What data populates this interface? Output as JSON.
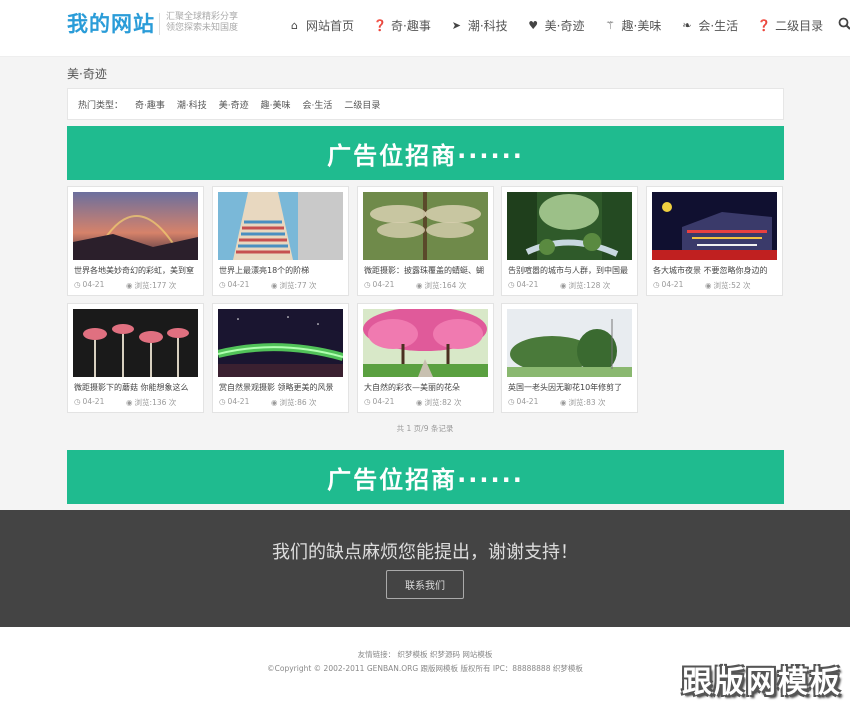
{
  "header": {
    "logo": "我的网站",
    "slogan_line1": "汇聚全球精彩分享",
    "slogan_line2": "领您探索未知国度",
    "nav": [
      {
        "label": "网站首页",
        "icon": "home-icon",
        "glyph": "⌂"
      },
      {
        "label": "奇·趣事",
        "icon": "question-circle-icon",
        "glyph": "❓"
      },
      {
        "label": "潮·科技",
        "icon": "paper-plane-icon",
        "glyph": "➤"
      },
      {
        "label": "美·奇迹",
        "icon": "heart-icon",
        "glyph": "♥"
      },
      {
        "label": "趣·美味",
        "icon": "cutlery-icon",
        "glyph": "⚚"
      },
      {
        "label": "会·生活",
        "icon": "leaf-icon",
        "glyph": "❧"
      },
      {
        "label": "二级目录",
        "icon": "question-circle-icon",
        "glyph": "❓"
      }
    ],
    "search_icon": "search-icon"
  },
  "breadcrumb": "美·奇迹",
  "hot": {
    "label": "热门类型：",
    "items": [
      "奇·趣事",
      "潮·科技",
      "美·奇迹",
      "趣·美味",
      "会·生活",
      "二级目录"
    ]
  },
  "banner_text": "广告位招商······",
  "articles": [
    {
      "title": "世界各地美妙奇幻的彩虹，美到窒",
      "date": "04-21",
      "views": "浏览:177 次"
    },
    {
      "title": "世界上最漂亮18个的阶梯",
      "date": "04-21",
      "views": "浏览:77 次"
    },
    {
      "title": "微距摄影：披露珠覆盖的蜻蜓、蝴",
      "date": "04-21",
      "views": "浏览:164 次"
    },
    {
      "title": "告别喧嚣的城市与人群，到中国最",
      "date": "04-21",
      "views": "浏览:128 次"
    },
    {
      "title": "各大城市夜景 不要忽略你身边的",
      "date": "04-21",
      "views": "浏览:52 次"
    },
    {
      "title": "微距摄影下的蘑菇 你能想象这么",
      "date": "04-21",
      "views": "浏览:136 次"
    },
    {
      "title": "赏自然景观摄影 领略更美的风景",
      "date": "04-21",
      "views": "浏览:86 次"
    },
    {
      "title": "大自然的彩衣—美丽的花朵",
      "date": "04-21",
      "views": "浏览:82 次"
    },
    {
      "title": "英国一老头因无聊花10年修剪了",
      "date": "04-21",
      "views": "浏览:83 次"
    }
  ],
  "pager": "共 1 页/9 条记录",
  "cta": {
    "text": "我们的缺点麻烦您能提出，谢谢支持！",
    "button": "联系我们"
  },
  "footer": {
    "links": "友情链接： 织梦模板 织梦源码 网站模板",
    "copyright": "©Copyright © 2002-2011 GENBAN.ORG 跟版网模板 版权所有  IPC：88888888 织梦模板"
  },
  "watermark": "跟版网模板",
  "colors": {
    "accent": "#1fbb8f",
    "logo": "#2a9cd8",
    "cta_bg": "#444444"
  }
}
